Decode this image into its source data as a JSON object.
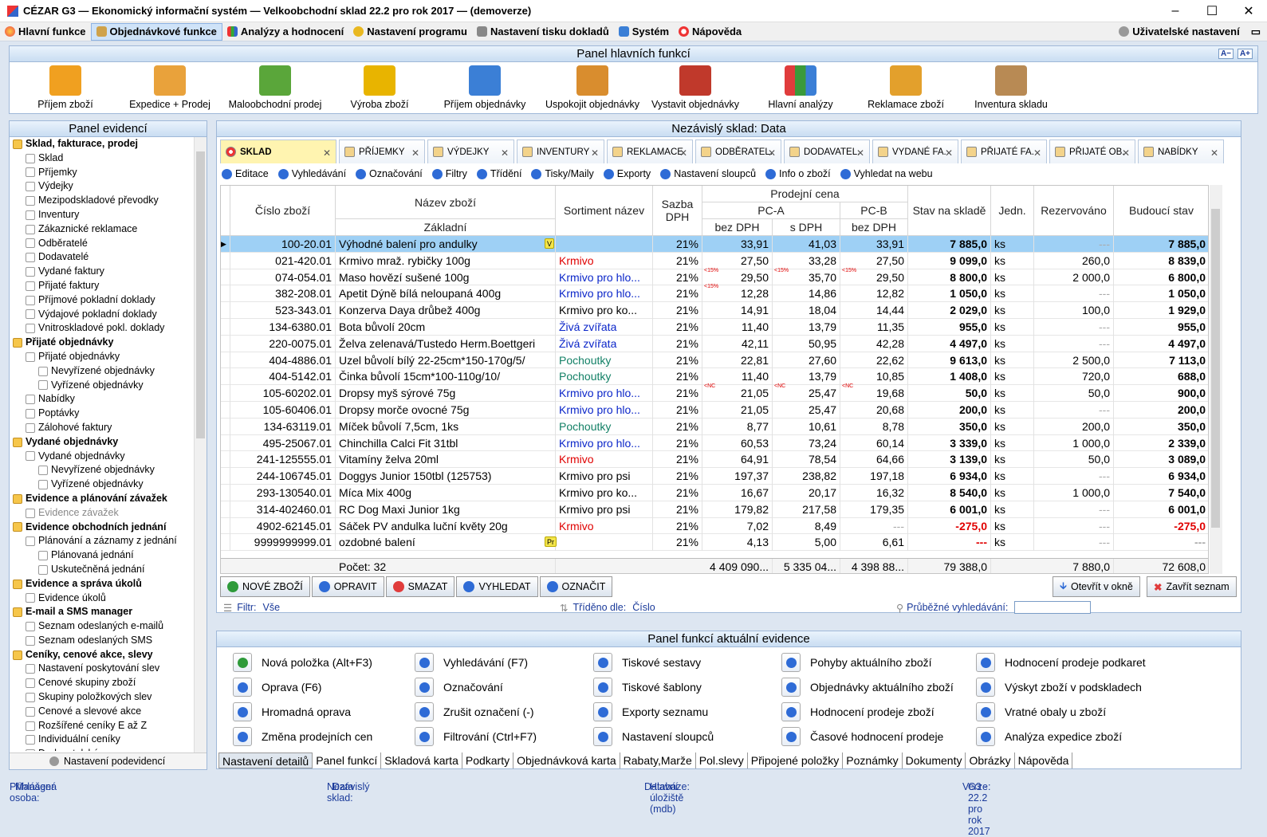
{
  "window": {
    "title": "CÉZAR G3 — Ekonomický informační systém — Velkoobchodní sklad 22.2 pro rok 2017 — (demoverze)"
  },
  "menu": [
    {
      "label": "Hlavní funkce",
      "icon": "globe-icon"
    },
    {
      "label": "Objednávkové funkce",
      "icon": "clipboard-icon"
    },
    {
      "label": "Analýzy a hodnocení",
      "icon": "bar-chart-icon"
    },
    {
      "label": "Nastavení programu",
      "icon": "gear-icon"
    },
    {
      "label": "Nastavení tisku dokladů",
      "icon": "printer-icon"
    },
    {
      "label": "Systém",
      "icon": "monitor-icon"
    },
    {
      "label": "Nápověda",
      "icon": "lifebuoy-icon"
    }
  ],
  "menu_right": {
    "label": "Uživatelské nastavení"
  },
  "main_panel": {
    "title": "Panel hlavních funkcí",
    "font_small": "A−",
    "font_big": "A+",
    "buttons": [
      {
        "label": "Příjem zboží",
        "icon": "forklift-icon",
        "color": "#f0a020"
      },
      {
        "label": "Expedice + Prodej",
        "icon": "cash-card-icon",
        "color": "#e9a23b"
      },
      {
        "label": "Maloobchodní prodej",
        "icon": "basket-icon",
        "color": "#5aa63a"
      },
      {
        "label": "Výroba zboží",
        "icon": "drill-icon",
        "color": "#e8b400"
      },
      {
        "label": "Příjem objednávky",
        "icon": "incoming-order-icon",
        "color": "#3b7fd6"
      },
      {
        "label": "Uspokojit objednávky",
        "icon": "satisfy-order-icon",
        "color": "#d98d2e"
      },
      {
        "label": "Vystavit objednávky",
        "icon": "outgoing-order-icon",
        "color": "#c0392b"
      },
      {
        "label": "Hlavní analýzy",
        "icon": "analysis-chart-icon",
        "color": "#e03c3c"
      },
      {
        "label": "Reklamace zboží",
        "icon": "warning-box-icon",
        "color": "#e3a02c"
      },
      {
        "label": "Inventura skladu",
        "icon": "inventory-clipboard-icon",
        "color": "#b88a54"
      }
    ]
  },
  "left_panel": {
    "title": "Panel evidencí",
    "bottom": "Nastavení podevidencí",
    "items": [
      {
        "label": "Sklad, fakturace, prodej",
        "level": 0,
        "group": true
      },
      {
        "label": "Sklad",
        "level": 1
      },
      {
        "label": "Příjemky",
        "level": 1
      },
      {
        "label": "Výdejky",
        "level": 1
      },
      {
        "label": "Mezipodskladové převodky",
        "level": 1
      },
      {
        "label": "Inventury",
        "level": 1
      },
      {
        "label": "Zákaznické reklamace",
        "level": 1
      },
      {
        "label": "Odběratelé",
        "level": 1
      },
      {
        "label": "Dodavatelé",
        "level": 1
      },
      {
        "label": "Vydané faktury",
        "level": 1
      },
      {
        "label": "Přijaté faktury",
        "level": 1
      },
      {
        "label": "Příjmové pokladní doklady",
        "level": 1
      },
      {
        "label": "Výdajové pokladní doklady",
        "level": 1
      },
      {
        "label": "Vnitroskladové pokl. doklady",
        "level": 1
      },
      {
        "label": "Přijaté objednávky",
        "level": 0,
        "group": true
      },
      {
        "label": "Přijaté objednávky",
        "level": 1
      },
      {
        "label": "Nevyřízené objednávky",
        "level": 2
      },
      {
        "label": "Vyřízené objednávky",
        "level": 2
      },
      {
        "label": "Nabídky",
        "level": 1
      },
      {
        "label": "Poptávky",
        "level": 1
      },
      {
        "label": "Zálohové faktury",
        "level": 1
      },
      {
        "label": "Vydané objednávky",
        "level": 0,
        "group": true
      },
      {
        "label": "Vydané objednávky",
        "level": 1
      },
      {
        "label": "Nevyřízené objednávky",
        "level": 2
      },
      {
        "label": "Vyřízené objednávky",
        "level": 2
      },
      {
        "label": "Evidence a plánování závažek",
        "level": 0,
        "group": true
      },
      {
        "label": "Evidence závažek",
        "level": 1,
        "disabled": true
      },
      {
        "label": "Evidence obchodních jednání",
        "level": 0,
        "group": true
      },
      {
        "label": "Plánování a záznamy z jednání",
        "level": 1
      },
      {
        "label": "Plánovaná jednání",
        "level": 2
      },
      {
        "label": "Uskutečněná jednání",
        "level": 2
      },
      {
        "label": "Evidence a správa úkolů",
        "level": 0,
        "group": true
      },
      {
        "label": "Evidence úkolů",
        "level": 1
      },
      {
        "label": "E-mail a SMS manager",
        "level": 0,
        "group": true
      },
      {
        "label": "Seznam odeslaných e-mailů",
        "level": 1
      },
      {
        "label": "Seznam odeslaných SMS",
        "level": 1
      },
      {
        "label": "Ceníky, cenové akce, slevy",
        "level": 0,
        "group": true
      },
      {
        "label": "Nastavení poskytování slev",
        "level": 1
      },
      {
        "label": "Cenové skupiny zboží",
        "level": 1
      },
      {
        "label": "Skupiny položkových slev",
        "level": 1
      },
      {
        "label": "Cenové a slevové akce",
        "level": 1
      },
      {
        "label": "Rozšířené ceníky E až Z",
        "level": 1
      },
      {
        "label": "Individuální ceníky",
        "level": 1
      },
      {
        "label": "Dodavatelské ceny",
        "level": 1
      }
    ]
  },
  "center": {
    "title": "Nezávislý sklad:  Data",
    "tabs": [
      "SKLAD",
      "PŘÍJEMKY",
      "VÝDEJKY",
      "INVENTURY",
      "REKLAMACE",
      "ODBĚRATEL.",
      "DODAVATEL.",
      "VYDANÉ FA.",
      "PŘIJATÉ FA.",
      "PŘIJATÉ OB.",
      "NABÍDKY"
    ],
    "toolbar": [
      "Editace",
      "Vyhledávání",
      "Označování",
      "Filtry",
      "Třídění",
      "Tisky/Maily",
      "Exporty",
      "Nastavení sloupců",
      "Info o zboží",
      "Vyhledat na webu"
    ],
    "headers": {
      "code": "Číslo zboží",
      "name": "Název zboží",
      "name_sub": "Základní",
      "sort": "Sortiment název",
      "vat": "Sazba DPH",
      "price": "Prodejní cena",
      "pca": "PC-A",
      "pcb": "PC-B",
      "no_vat": "bez DPH",
      "with_vat": "s DPH",
      "no_vat_b": "bez DPH",
      "stock": "Stav na skladě",
      "unit": "Jedn.",
      "reserved": "Rezervováno",
      "future": "Budoucí stav"
    },
    "rows": [
      {
        "code": "100-20.01",
        "name": "Výhodné balení pro andulky",
        "badge": "V",
        "sort": "",
        "sc": "",
        "vat": "21%",
        "f1": "",
        "a": "33,91",
        "f2": "",
        "b": "41,03",
        "f3": "",
        "c": "33,91",
        "stock": "7 885,0",
        "unit": "ks",
        "res": "---",
        "fut": "7 885,0"
      },
      {
        "code": "021-420.01",
        "name": "Krmivo mraž. rybičky 100g",
        "badge": "",
        "sort": "Krmivo",
        "sc": "red",
        "vat": "21%",
        "f1": "",
        "a": "27,50",
        "f2": "",
        "b": "33,28",
        "f3": "",
        "c": "27,50",
        "stock": "9 099,0",
        "unit": "ks",
        "res": "260,0",
        "fut": "8 839,0"
      },
      {
        "code": "074-054.01",
        "name": "Maso hovězí sušené 100g",
        "badge": "",
        "sort": "Krmivo pro hlo...",
        "sc": "blue",
        "vat": "21%",
        "f1": "<15%",
        "a": "29,50",
        "f2": "<15%",
        "b": "35,70",
        "f3": "<15%",
        "c": "29,50",
        "stock": "8 800,0",
        "unit": "ks",
        "res": "2 000,0",
        "fut": "6 800,0"
      },
      {
        "code": "382-208.01",
        "name": "Apetit Dýně bílá neloupaná 400g",
        "badge": "",
        "sort": "Krmivo pro hlo...",
        "sc": "blue",
        "vat": "21%",
        "f1": "<15%",
        "a": "12,28",
        "f2": "",
        "b": "14,86",
        "f3": "",
        "c": "12,82",
        "stock": "1 050,0",
        "unit": "ks",
        "res": "---",
        "fut": "1 050,0"
      },
      {
        "code": "523-343.01",
        "name": "Konzerva Daya drůbež 400g",
        "badge": "",
        "sort": "Krmivo pro ko...",
        "sc": "",
        "vat": "21%",
        "f1": "",
        "a": "14,91",
        "f2": "",
        "b": "18,04",
        "f3": "",
        "c": "14,44",
        "stock": "2 029,0",
        "unit": "ks",
        "res": "100,0",
        "fut": "1 929,0"
      },
      {
        "code": "134-6380.01",
        "name": "Bota bůvolí 20cm",
        "badge": "",
        "sort": "Živá zvířata",
        "sc": "blue",
        "vat": "21%",
        "f1": "",
        "a": "11,40",
        "f2": "",
        "b": "13,79",
        "f3": "",
        "c": "11,35",
        "stock": "955,0",
        "unit": "ks",
        "res": "---",
        "fut": "955,0"
      },
      {
        "code": "220-0075.01",
        "name": "Želva zelenavá/Tustedo Herm.Boettgeri",
        "badge": "",
        "sort": "Živá zvířata",
        "sc": "blue",
        "vat": "21%",
        "f1": "",
        "a": "42,11",
        "f2": "",
        "b": "50,95",
        "f3": "",
        "c": "42,28",
        "stock": "4 497,0",
        "unit": "ks",
        "res": "---",
        "fut": "4 497,0"
      },
      {
        "code": "404-4886.01",
        "name": "Uzel bůvolí bílý 22-25cm*150-170g/5/",
        "badge": "",
        "sort": "Pochoutky",
        "sc": "teal",
        "vat": "21%",
        "f1": "",
        "a": "22,81",
        "f2": "",
        "b": "27,60",
        "f3": "",
        "c": "22,62",
        "stock": "9 613,0",
        "unit": "ks",
        "res": "2 500,0",
        "fut": "7 113,0"
      },
      {
        "code": "404-5142.01",
        "name": "Činka bůvolí 15cm*100-110g/10/",
        "badge": "",
        "sort": "Pochoutky",
        "sc": "teal",
        "vat": "21%",
        "f1": "",
        "a": "11,40",
        "f2": "",
        "b": "13,79",
        "f3": "",
        "c": "10,85",
        "stock": "1 408,0",
        "unit": "ks",
        "res": "720,0",
        "fut": "688,0"
      },
      {
        "code": "105-60202.01",
        "name": "Dropsy myš sýrové 75g",
        "badge": "",
        "sort": "Krmivo pro hlo...",
        "sc": "blue",
        "vat": "21%",
        "f1": "<NC",
        "a": "21,05",
        "f2": "<NC",
        "b": "25,47",
        "f3": "<NC",
        "c": "19,68",
        "stock": "50,0",
        "unit": "ks",
        "res": "50,0",
        "fut": "900,0"
      },
      {
        "code": "105-60406.01",
        "name": "Dropsy morče ovocné 75g",
        "badge": "",
        "sort": "Krmivo pro hlo...",
        "sc": "blue",
        "vat": "21%",
        "f1": "",
        "a": "21,05",
        "f2": "",
        "b": "25,47",
        "f3": "",
        "c": "20,68",
        "stock": "200,0",
        "unit": "ks",
        "res": "---",
        "fut": "200,0"
      },
      {
        "code": "134-63119.01",
        "name": "Míček bůvolí 7,5cm, 1ks",
        "badge": "",
        "sort": "Pochoutky",
        "sc": "teal",
        "vat": "21%",
        "f1": "",
        "a": "8,77",
        "f2": "",
        "b": "10,61",
        "f3": "",
        "c": "8,78",
        "stock": "350,0",
        "unit": "ks",
        "res": "200,0",
        "fut": "350,0"
      },
      {
        "code": "495-25067.01",
        "name": "Chinchilla Calci Fit 31tbl",
        "badge": "",
        "sort": "Krmivo pro hlo...",
        "sc": "blue",
        "vat": "21%",
        "f1": "",
        "a": "60,53",
        "f2": "",
        "b": "73,24",
        "f3": "",
        "c": "60,14",
        "stock": "3 339,0",
        "unit": "ks",
        "res": "1 000,0",
        "fut": "2 339,0"
      },
      {
        "code": "241-125555.01",
        "name": "Vitamíny želva 20ml",
        "badge": "",
        "sort": "Krmivo",
        "sc": "red",
        "vat": "21%",
        "f1": "",
        "a": "64,91",
        "f2": "",
        "b": "78,54",
        "f3": "",
        "c": "64,66",
        "stock": "3 139,0",
        "unit": "ks",
        "res": "50,0",
        "fut": "3 089,0"
      },
      {
        "code": "244-106745.01",
        "name": "Doggys Junior 150tbl (125753)",
        "badge": "",
        "sort": "Krmivo pro psi",
        "sc": "",
        "vat": "21%",
        "f1": "",
        "a": "197,37",
        "f2": "",
        "b": "238,82",
        "f3": "",
        "c": "197,18",
        "stock": "6 934,0",
        "unit": "ks",
        "res": "---",
        "fut": "6 934,0"
      },
      {
        "code": "293-130540.01",
        "name": "Míca Mix 400g",
        "badge": "",
        "sort": "Krmivo pro ko...",
        "sc": "",
        "vat": "21%",
        "f1": "",
        "a": "16,67",
        "f2": "",
        "b": "20,17",
        "f3": "",
        "c": "16,32",
        "stock": "8 540,0",
        "unit": "ks",
        "res": "1 000,0",
        "fut": "7 540,0"
      },
      {
        "code": "314-402460.01",
        "name": "RC Dog Maxi Junior 1kg",
        "badge": "",
        "sort": "Krmivo pro psi",
        "sc": "",
        "vat": "21%",
        "f1": "",
        "a": "179,82",
        "f2": "",
        "b": "217,58",
        "f3": "",
        "c": "179,35",
        "stock": "6 001,0",
        "unit": "ks",
        "res": "---",
        "fut": "6 001,0"
      },
      {
        "code": "4902-62145.01",
        "name": "Sáček PV andulka luční květy 20g",
        "badge": "",
        "sort": "Krmivo",
        "sc": "red",
        "vat": "21%",
        "f1": "",
        "a": "7,02",
        "f2": "",
        "b": "8,49",
        "f3": "",
        "c": "---",
        "stock": "-275,0",
        "unit": "ks",
        "res": "---",
        "fut": "-275,0"
      },
      {
        "code": "9999999999.01",
        "name": "ozdobné balení",
        "badge": "Pr",
        "sort": "",
        "sc": "",
        "vat": "21%",
        "f1": "",
        "a": "4,13",
        "f2": "",
        "b": "5,00",
        "f3": "",
        "c": "6,61",
        "stock": "---",
        "unit": "ks",
        "res": "---",
        "fut": "---"
      }
    ],
    "totals": {
      "label": "Počet: 32",
      "a": "4 409 090...",
      "b": "5 335 04...",
      "c": "4 398 88...",
      "stock": "79 388,0",
      "res": "7 880,0",
      "fut": "72 608,0"
    },
    "buttons": [
      "NOVÉ ZBOŽÍ",
      "OPRAVIT",
      "SMAZAT",
      "VYHLEDAT",
      "OZNAČIT"
    ],
    "open_window": "Otevřít v okně",
    "close_list": "Zavřít seznam",
    "filter_label": "Filtr:",
    "filter_value": "Vše",
    "sort_label": "Tříděno dle:",
    "sort_value": "Číslo",
    "search_label": "Průběžné vyhledávání:"
  },
  "func_panel": {
    "title": "Panel funkcí aktuální evidence",
    "cols": [
      [
        "Nová položka (Alt+F3)",
        "Oprava (F6)",
        "Hromadná oprava",
        "Změna prodejních cen"
      ],
      [
        "Vyhledávání (F7)",
        "Označování",
        "Zrušit označení (-)",
        "Filtrování (Ctrl+F7)"
      ],
      [
        "Tiskové sestavy",
        "Tiskové šablony",
        "Exporty seznamu",
        "Nastavení sloupců"
      ],
      [
        "Pohyby aktuálního zboží",
        "Objednávky aktuálního zboží",
        "Hodnocení prodeje zboží",
        "Časové hodnocení prodeje"
      ],
      [
        "Hodnocení prodeje podkaret",
        "Výskyt zboží v podskladech",
        "Vratné obaly u zboží",
        "Analýza expedice zboží"
      ]
    ],
    "tabs": [
      "Nastavení detailů",
      "Panel funkcí",
      "Skladová karta",
      "Podkarty",
      "Objednávková karta",
      "Rabaty,Marže",
      "Pol.slevy",
      "Připojené položky",
      "Poznámky",
      "Dokumenty",
      "Obrázky",
      "Nápověda"
    ]
  },
  "status": {
    "user_label": "Přihlášená osoba:",
    "user": "Manager",
    "store_label": "Nezávislý sklad:",
    "store": "Data",
    "db_label": "Databáze:",
    "db": "Hlavní úložiště  (mdb)",
    "ver_label": "Verze:",
    "ver": "G3 - 22.2 pro rok 2017"
  }
}
